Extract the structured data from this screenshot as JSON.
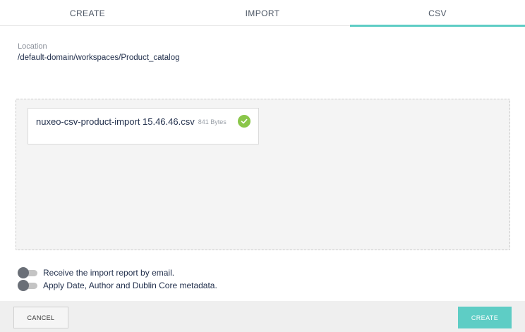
{
  "tabs": [
    {
      "label": "CREATE",
      "active": false
    },
    {
      "label": "IMPORT",
      "active": false
    },
    {
      "label": "CSV",
      "active": true
    }
  ],
  "location": {
    "label": "Location",
    "path": "/default-domain/workspaces/Product_catalog"
  },
  "upload": {
    "file_name": "nuxeo-csv-product-import 15.46.46.csv",
    "file_size": "841 Bytes",
    "status_icon": "check-circle-icon"
  },
  "options": [
    {
      "label": "Receive the import report by email.",
      "enabled": false
    },
    {
      "label": "Apply Date, Author and Dublin Core metadata.",
      "enabled": false
    }
  ],
  "footer": {
    "cancel_label": "CANCEL",
    "create_label": "CREATE"
  },
  "colors": {
    "accent": "#5ecdc5",
    "success": "#8ac64a",
    "text_primary": "#1f2d4a"
  }
}
